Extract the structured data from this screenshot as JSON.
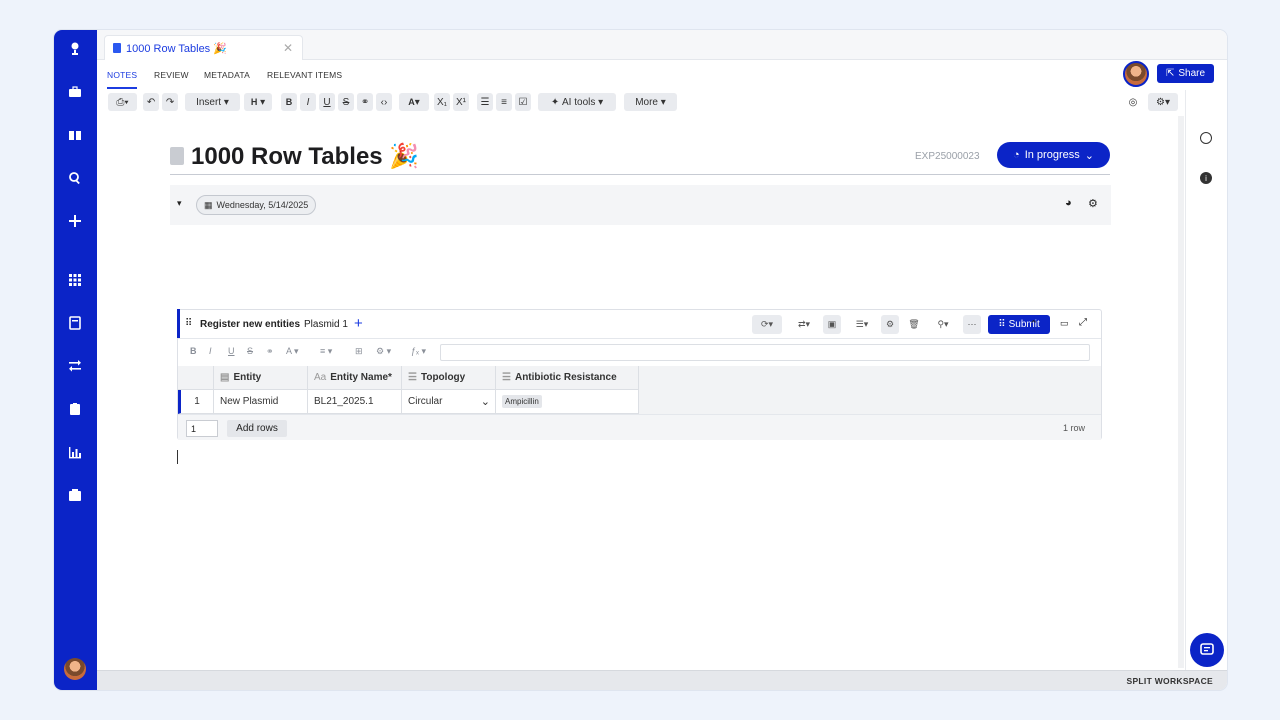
{
  "document": {
    "tab_title": "1000 Row Tables 🎉",
    "title": "1000 Row Tables 🎉",
    "exp_id": "EXP25000023",
    "status": "In progress",
    "date": "Wednesday, 5/14/2025"
  },
  "subnav": [
    "NOTES",
    "REVIEW",
    "METADATA",
    "RELEVANT ITEMS"
  ],
  "share_label": "Share",
  "toolbar": {
    "insert": "Insert",
    "heading": "H",
    "ai_tools": "AI tools",
    "more": "More"
  },
  "table": {
    "title": "Register new entities",
    "subtitle": "Plasmid 1",
    "submit": "Submit",
    "columns": [
      "Entity",
      "Entity Name*",
      "Topology",
      "Antibiotic Resistance"
    ],
    "rows": [
      {
        "num": "1",
        "entity": "New Plasmid",
        "name": "BL21_2025.1",
        "topology": "Circular",
        "resistance": "Ampicillin"
      }
    ],
    "add_count": "1",
    "add_rows": "Add rows",
    "row_count": "1 row"
  },
  "footer": {
    "split_workspace": "SPLIT WORKSPACE"
  },
  "colors": {
    "brand": "#0b24c7"
  }
}
